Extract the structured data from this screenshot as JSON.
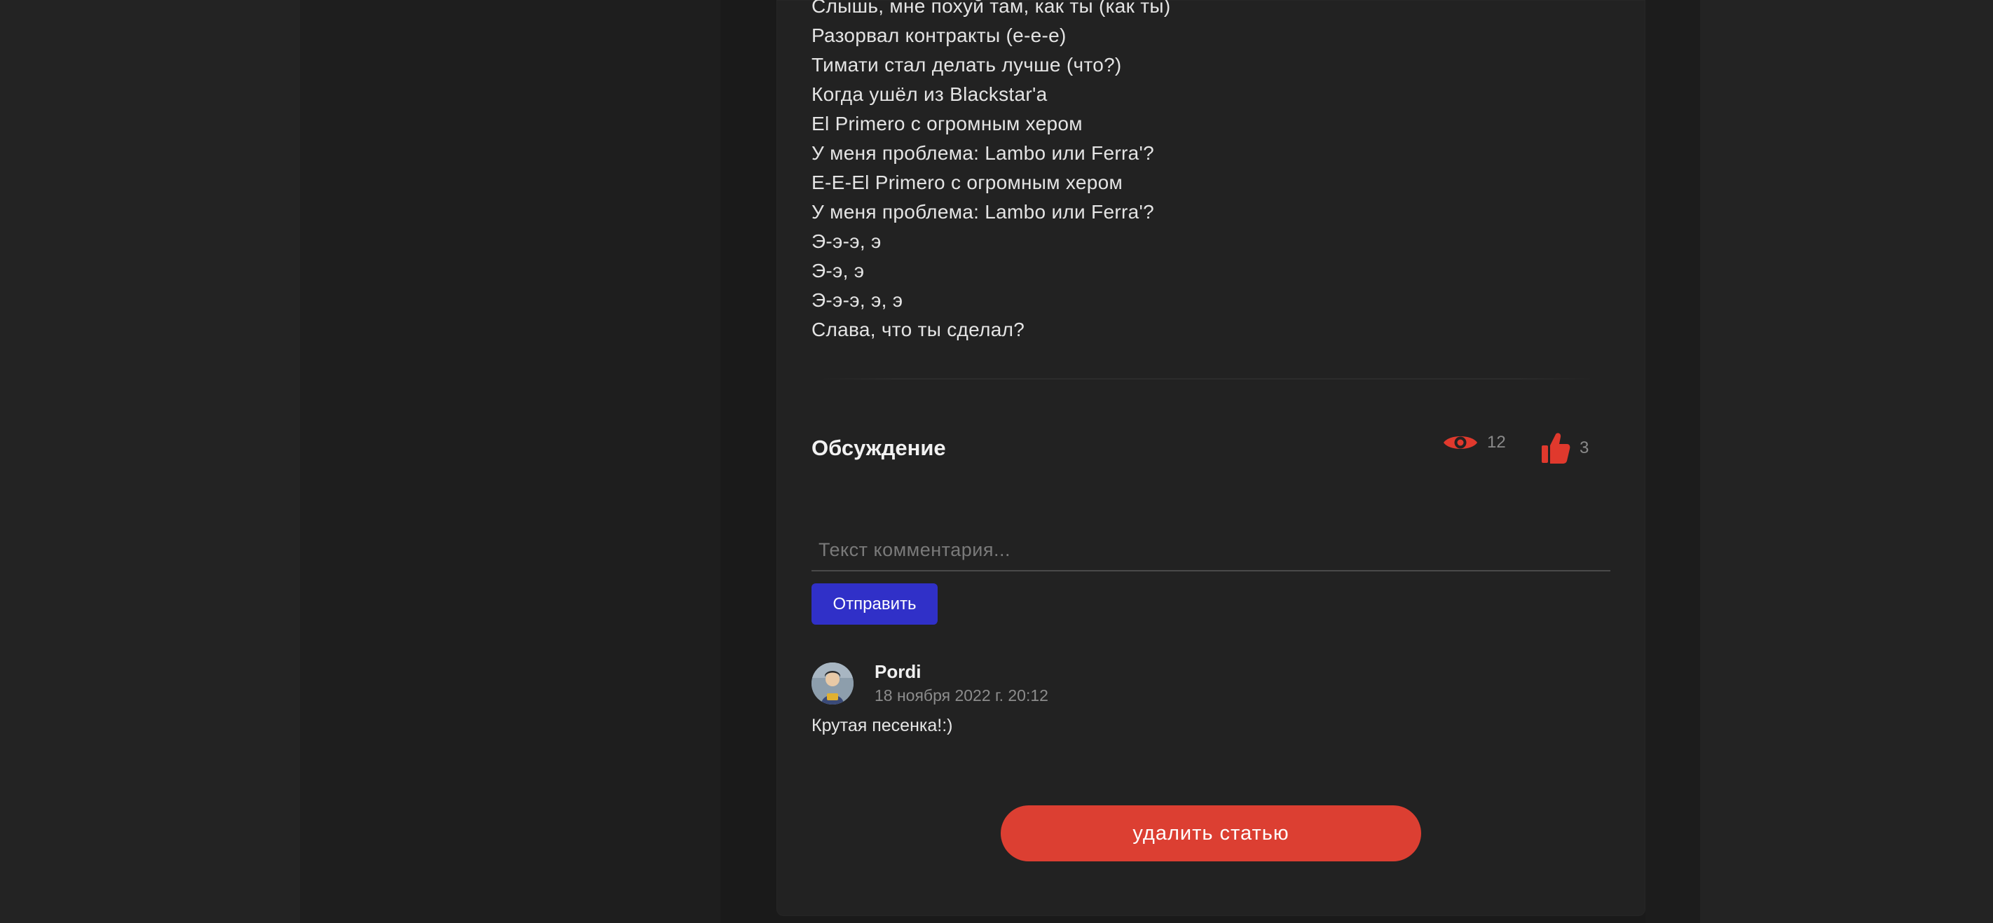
{
  "lyrics": [
    "Слышь, мне похуй там, как ты (как ты)",
    "Разорвал контракты (е-е-е)",
    "Тимати стал делать лучше (что?)",
    "Когда ушёл из Blackstar'а",
    "El Primero с огромным хером",
    "У меня проблема: Lambo или Ferra'?",
    "E-E-El Primero с огромным хером",
    "У меня проблема: Lambo или Ferra'?",
    "Э-э-э, э",
    "Э-э, э",
    "Э-э-э, э, э",
    "Слава, что ты сделал?"
  ],
  "discussion": {
    "title": "Обсуждение",
    "views": "12",
    "likes": "3",
    "comment_placeholder": "Текст комментария...",
    "send_label": "Отправить"
  },
  "comments": [
    {
      "author": "Pordi",
      "date": "18 ноября 2022 г. 20:12",
      "text": "Крутая песенка!:)"
    }
  ],
  "delete_label": "удалить статью",
  "colors": {
    "accent_red": "#dc3f32",
    "send_blue": "#3030c8",
    "icon_red": "#e0392d"
  },
  "icons": {
    "views": "eye-icon",
    "likes": "thumbs-up-icon"
  }
}
